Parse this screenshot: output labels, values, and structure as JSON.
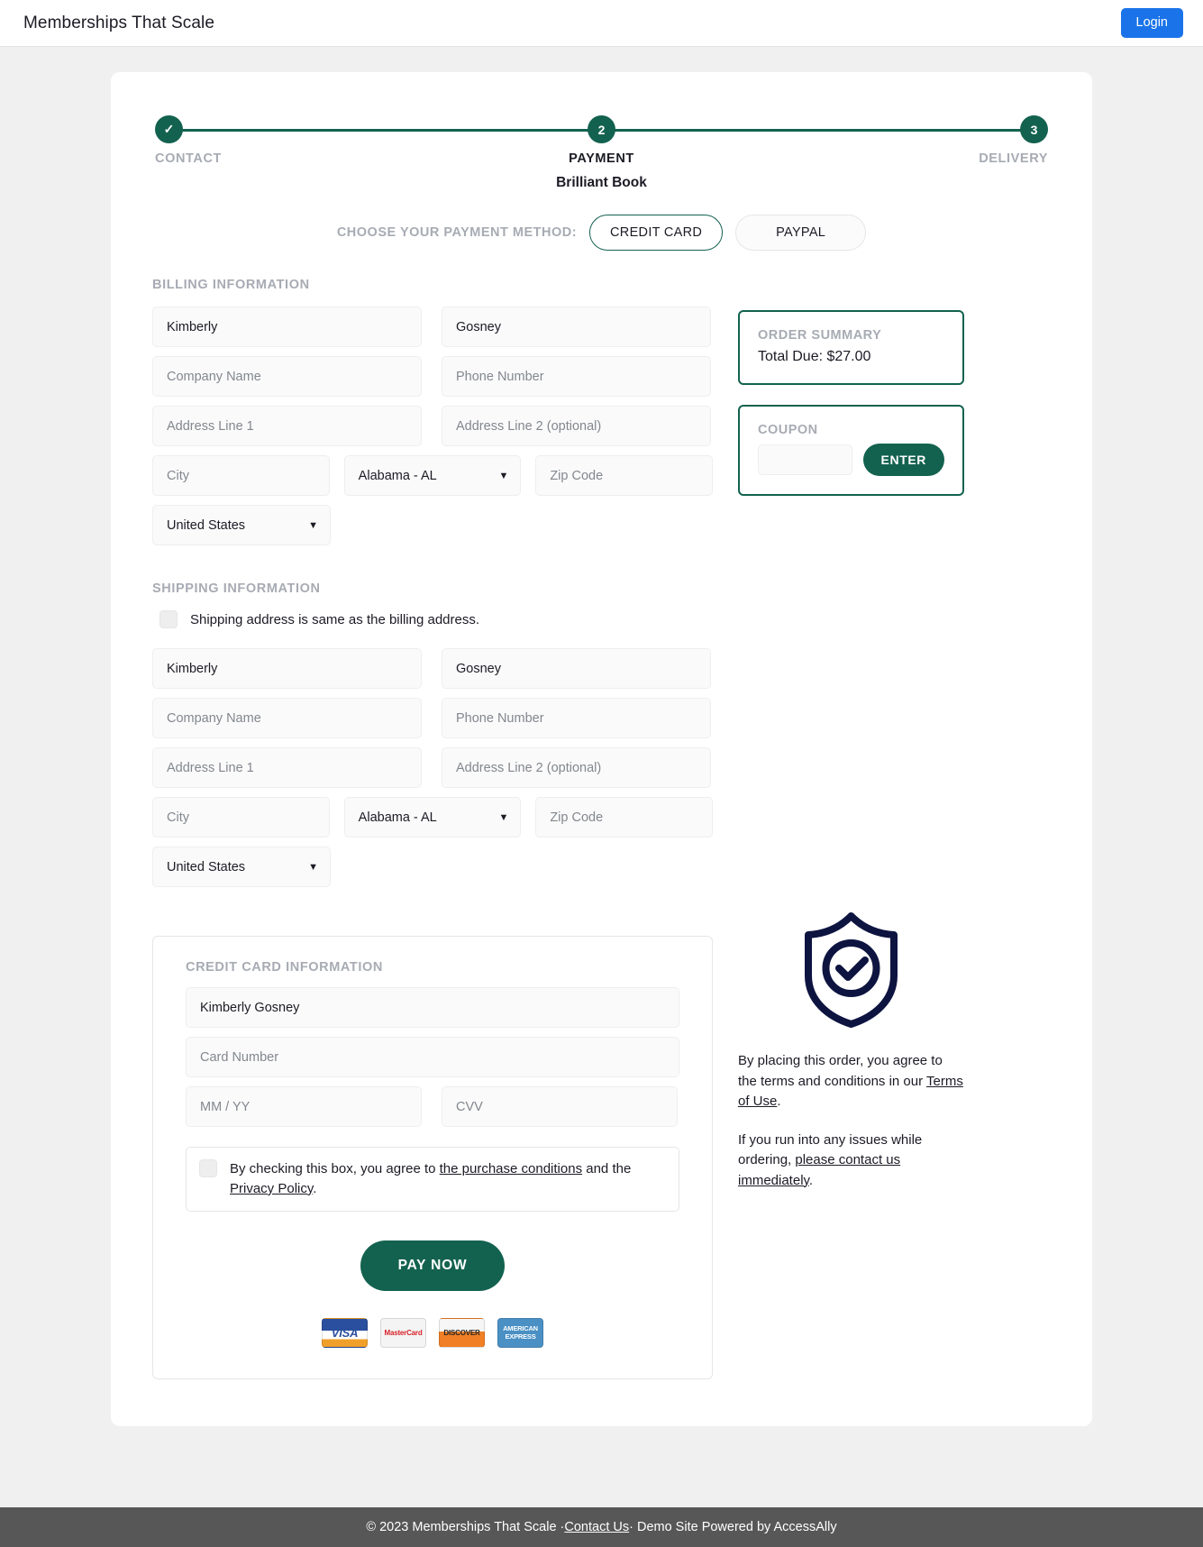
{
  "header": {
    "site_title": "Memberships That Scale",
    "login_label": "Login"
  },
  "stepper": {
    "steps": [
      {
        "marker": "✓",
        "label": "CONTACT",
        "state": "complete"
      },
      {
        "marker": "2",
        "label": "PAYMENT",
        "state": "active"
      },
      {
        "marker": "3",
        "label": "DELIVERY",
        "state": "upcoming"
      }
    ]
  },
  "product": {
    "title": "Brilliant Book"
  },
  "payment_method": {
    "label": "CHOOSE YOUR PAYMENT METHOD:",
    "options": [
      {
        "label": "CREDIT CARD",
        "selected": true
      },
      {
        "label": "PAYPAL",
        "selected": false
      }
    ]
  },
  "billing": {
    "heading": "BILLING INFORMATION",
    "first_name_value": "Kimberly",
    "last_name_value": "Gosney",
    "company_placeholder": "Company Name",
    "phone_placeholder": "Phone Number",
    "address1_placeholder": "Address Line 1",
    "address2_placeholder": "Address Line 2 (optional)",
    "city_placeholder": "City",
    "state_value": "Alabama - AL",
    "zip_placeholder": "Zip Code",
    "country_value": "United States"
  },
  "order_summary": {
    "heading": "ORDER SUMMARY",
    "total_due": "Total Due: $27.00"
  },
  "coupon": {
    "heading": "COUPON",
    "value": "",
    "enter_label": "ENTER"
  },
  "shipping": {
    "heading": "SHIPPING INFORMATION",
    "same_as_billing_label": "Shipping address is same as the billing address.",
    "same_as_billing_checked": false,
    "first_name_value": "Kimberly",
    "last_name_value": "Gosney",
    "company_placeholder": "Company Name",
    "phone_placeholder": "Phone Number",
    "address1_placeholder": "Address Line 1",
    "address2_placeholder": "Address Line 2 (optional)",
    "city_placeholder": "City",
    "state_value": "Alabama - AL",
    "zip_placeholder": "Zip Code",
    "country_value": "United States"
  },
  "credit_card": {
    "heading": "CREDIT CARD INFORMATION",
    "name_value": "Kimberly Gosney",
    "number_placeholder": "Card Number",
    "expiry_placeholder": "MM / YY",
    "cvv_placeholder": "CVV",
    "terms_checked": false,
    "terms_prefix": "By checking this box, you agree to ",
    "terms_link1": "the purchase conditions",
    "terms_middle": " and the ",
    "terms_link2": "Privacy Policy",
    "terms_suffix": ".",
    "pay_now_label": "PAY NOW",
    "accepted_cards": [
      "VISA",
      "MasterCard",
      "DISCOVER",
      "AMERICAN EXPRESS"
    ]
  },
  "assurance": {
    "shield_icon": "shield-check-icon",
    "legal_1_prefix": "By placing this order, you agree to the terms and conditions in our ",
    "legal_1_link": "Terms of Use",
    "legal_1_suffix": ".",
    "legal_2_prefix": "If you run into any issues while ordering, ",
    "legal_2_link": "please contact us immediately",
    "legal_2_suffix": "."
  },
  "footer": {
    "copyright": "© 2023 Memberships That Scale · ",
    "contact_link": "Contact Us",
    "suffix": " · Demo Site Powered by AccessAlly"
  },
  "colors": {
    "brand_green": "#13624f",
    "login_blue": "#1a73e8",
    "muted_label": "#a7abb3",
    "footer_bg": "#575757",
    "shield_navy": "#0d1440"
  }
}
